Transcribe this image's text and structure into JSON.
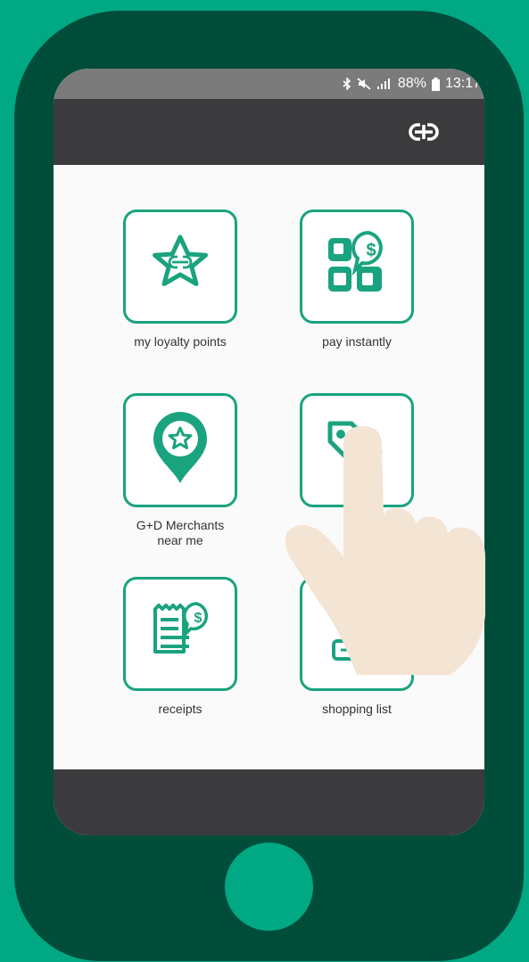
{
  "colors": {
    "background": "#00a883",
    "phone_body": "#004d3a",
    "status_bar": "#7b7b7b",
    "app_bar": "#3b3b3e",
    "accent": "#1aa37f",
    "hand": "#f4e4d3"
  },
  "status_bar": {
    "icons": [
      "bluetooth-icon",
      "mute-icon",
      "signal-icon",
      "battery-icon"
    ],
    "battery": "88%",
    "time": "13:17"
  },
  "app_bar": {
    "logo_icon": "gd-logo-icon"
  },
  "tiles": [
    {
      "label": "my loyalty points",
      "icon": "star-logo-icon"
    },
    {
      "label": "pay instantly",
      "icon": "pay-grid-icon"
    },
    {
      "label": "G+D Merchants\nnear me",
      "icon": "location-star-icon"
    },
    {
      "label": "",
      "icon": "tag-icon"
    },
    {
      "label": "receipts",
      "icon": "receipt-icon"
    },
    {
      "label": "shopping list",
      "icon": "shopping-list-icon"
    }
  ]
}
